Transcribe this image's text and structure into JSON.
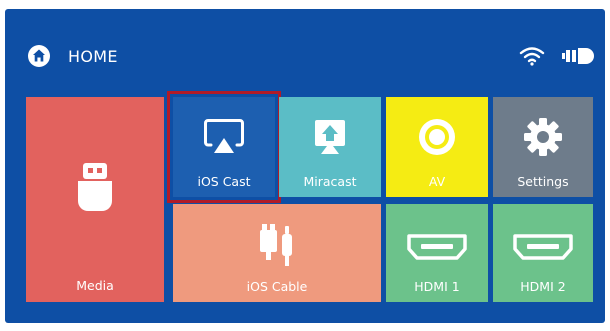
{
  "header": {
    "title": "HOME",
    "home_icon": "home-icon",
    "status_icons": [
      "wifi-icon",
      "battery-icon"
    ]
  },
  "tiles": {
    "media": {
      "label": "Media",
      "icon": "usb-drive-icon",
      "color": "#e2625e"
    },
    "ios_cast": {
      "label": "iOS Cast",
      "icon": "airplay-icon",
      "color": "#1d5fb0",
      "selected": true
    },
    "miracast": {
      "label": "Miracast",
      "icon": "screen-cast-icon",
      "color": "#5bbdc6"
    },
    "av": {
      "label": "AV",
      "icon": "av-port-icon",
      "color": "#f5ec13"
    },
    "settings": {
      "label": "Settings",
      "icon": "gear-icon",
      "color": "#6e7c8b"
    },
    "ios_cable": {
      "label": "iOS Cable",
      "icon": "lightning-cable-icon",
      "color": "#ef9a7e"
    },
    "hdmi1": {
      "label": "HDMI 1",
      "icon": "hdmi-port-icon",
      "color": "#6cc28b"
    },
    "hdmi2": {
      "label": "HDMI 2",
      "icon": "hdmi-port-icon",
      "color": "#6cc28b"
    }
  },
  "selection_color": "#b01b28"
}
